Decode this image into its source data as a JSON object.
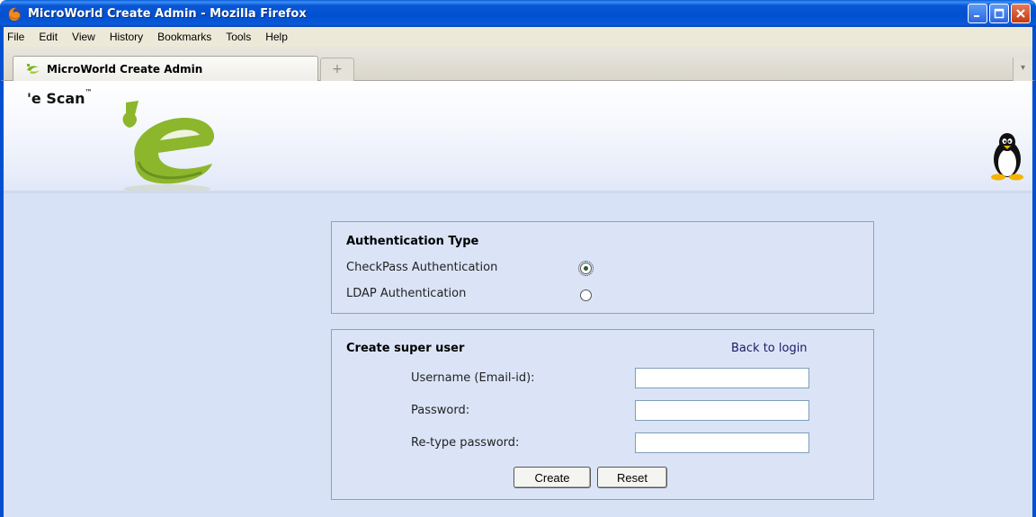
{
  "window": {
    "title": "MicroWorld Create Admin - Mozilla Firefox"
  },
  "menu": [
    "File",
    "Edit",
    "View",
    "History",
    "Bookmarks",
    "Tools",
    "Help"
  ],
  "tab": {
    "label": "MicroWorld Create Admin",
    "new_tab_symbol": "+",
    "list_symbol": "▾"
  },
  "header": {
    "brand": "'e Scan",
    "trademark": "™"
  },
  "auth": {
    "title": "Authentication Type",
    "options": [
      {
        "label": "CheckPass Authentication",
        "checked": true
      },
      {
        "label": "LDAP Authentication",
        "checked": false
      }
    ]
  },
  "superuser": {
    "title": "Create super user",
    "back_link": "Back to login",
    "fields": {
      "username_label": "Username (Email-id):",
      "username_value": "",
      "password_label": "Password:",
      "password_value": "",
      "retype_label": "Re-type password:",
      "retype_value": ""
    },
    "buttons": {
      "create": "Create",
      "reset": "Reset"
    }
  },
  "colors": {
    "titlebar": "#0050d0",
    "page_background": "#d8e2f6",
    "panel_border": "#8aa0c8",
    "logo_green": "#8cb62c"
  },
  "icons": [
    "firefox-icon",
    "minimize-icon",
    "maximize-icon",
    "close-icon",
    "escan-favicon",
    "escan-logo",
    "linux-penguin-icon"
  ]
}
